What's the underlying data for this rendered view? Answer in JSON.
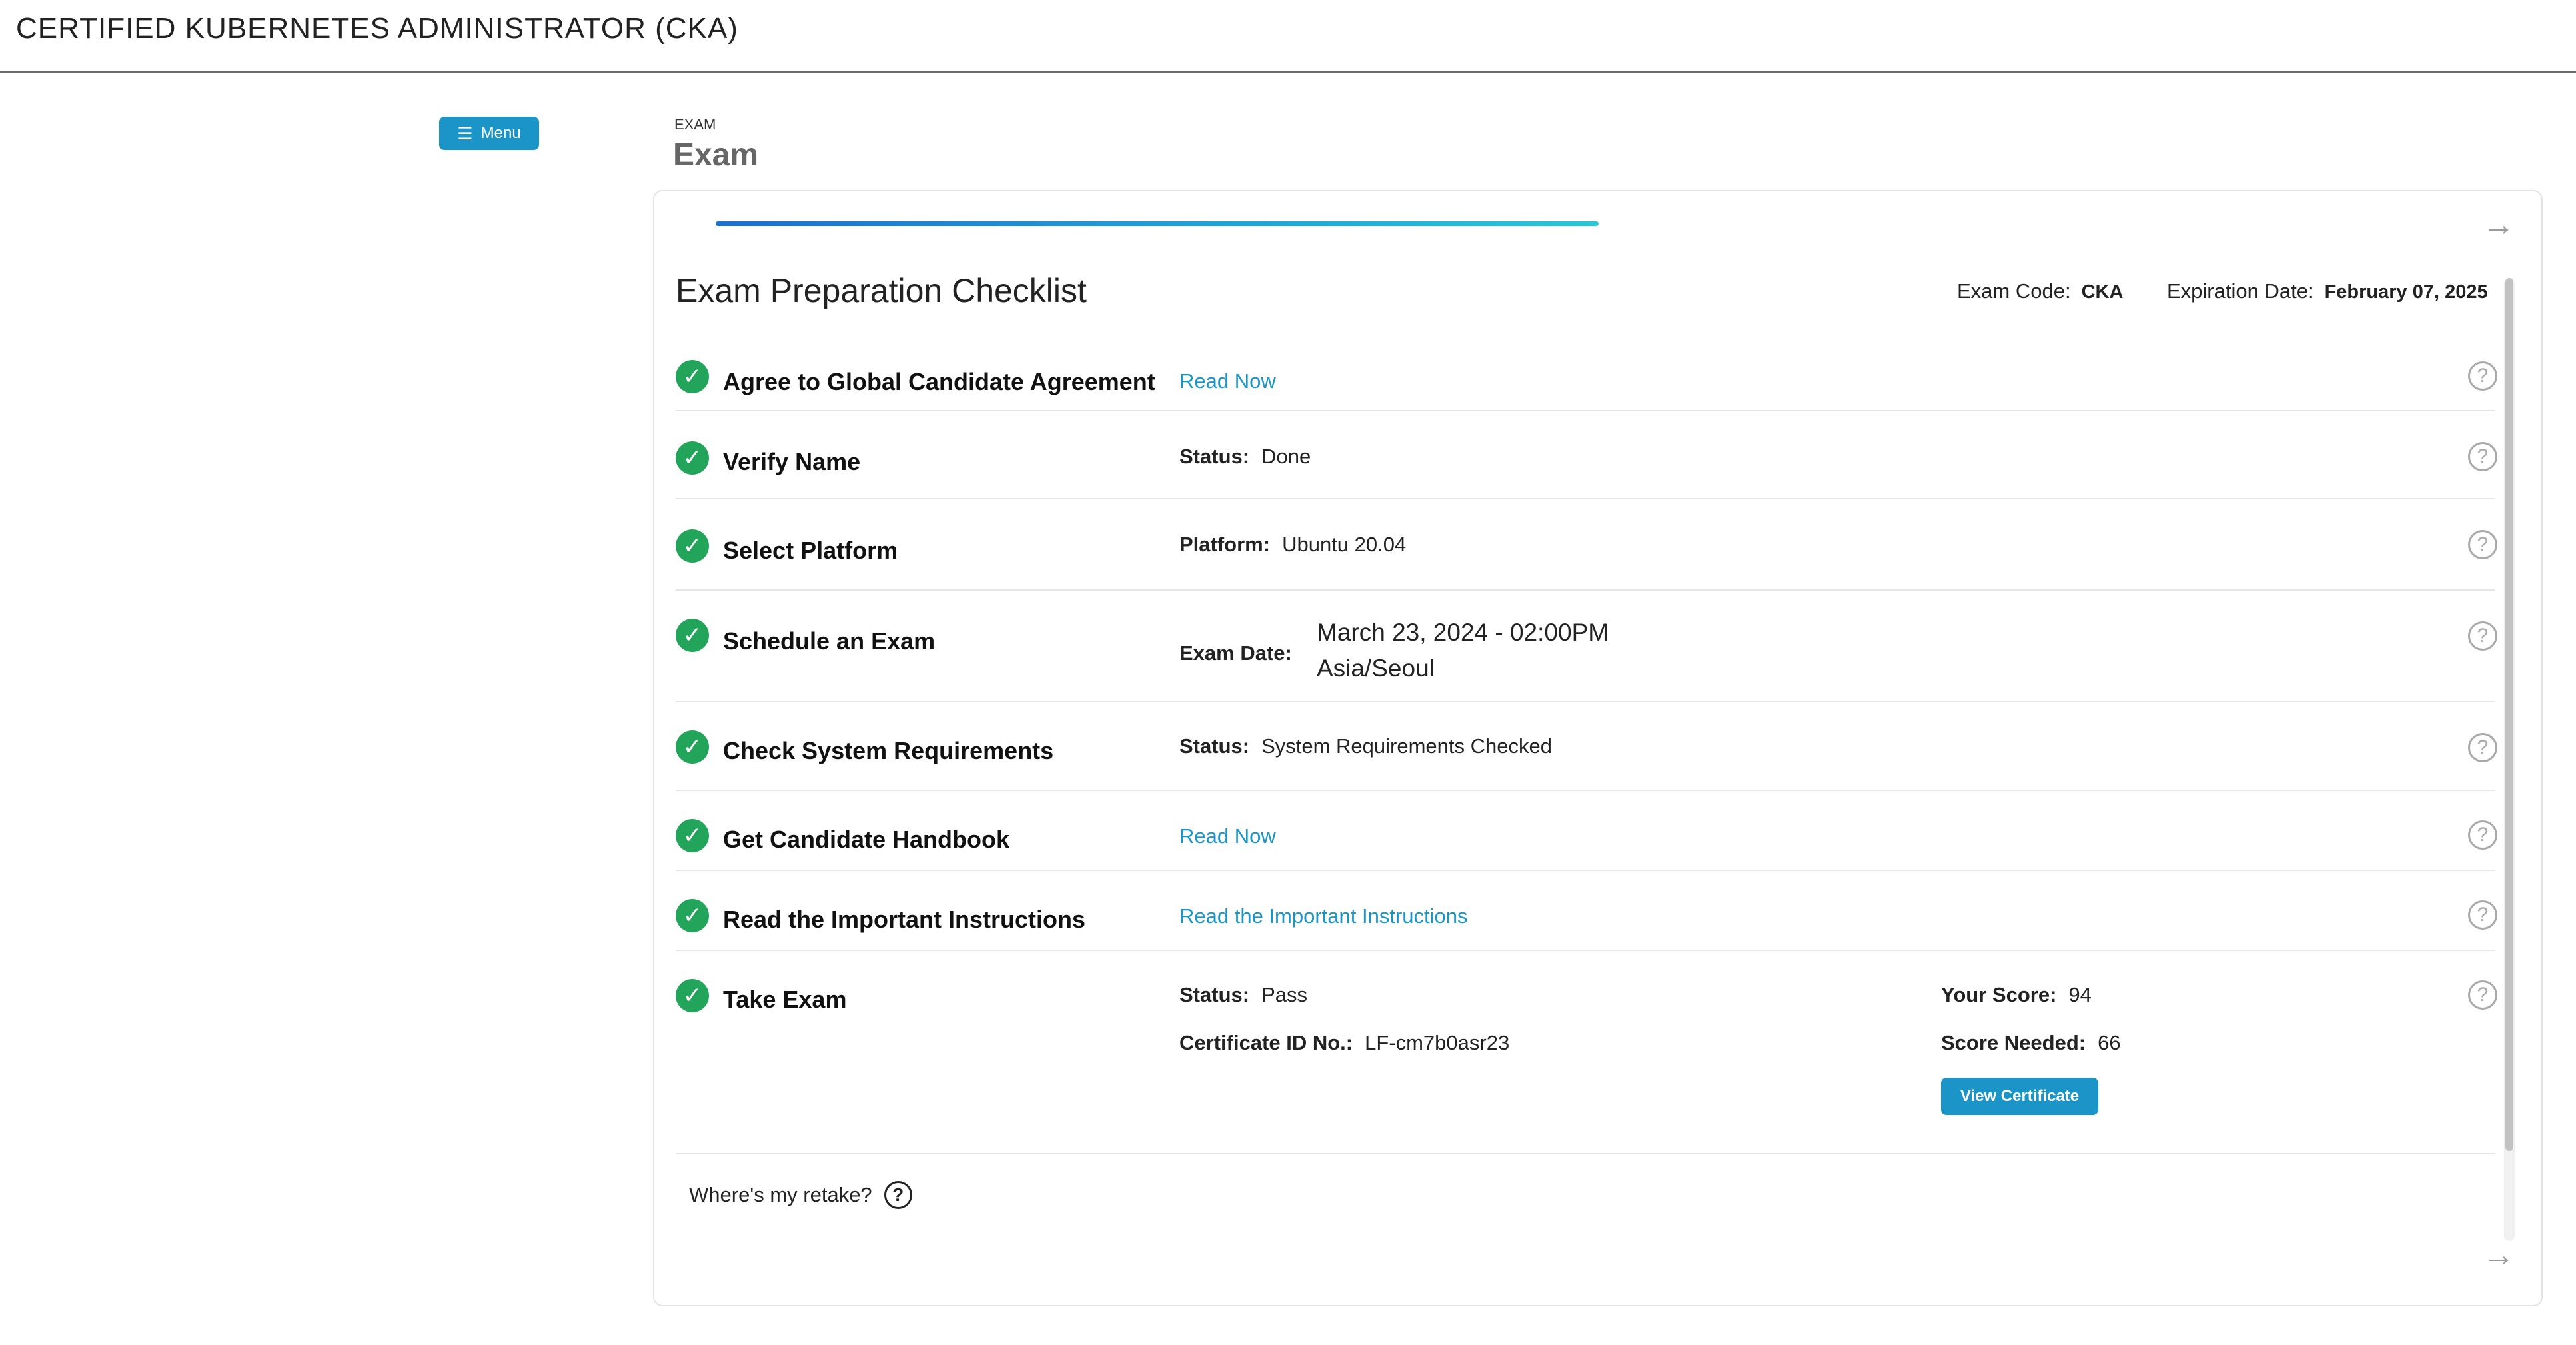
{
  "header": {
    "title": "CERTIFIED KUBERNETES ADMINISTRATOR (CKA)"
  },
  "menu": {
    "label": "Menu"
  },
  "page": {
    "breadcrumb": "EXAM",
    "title": "Exam"
  },
  "checklist": {
    "title": "Exam Preparation Checklist",
    "exam_code_label": "Exam Code:",
    "exam_code": "CKA",
    "expiration_label": "Expiration Date:",
    "expiration_date": "February 07, 2025",
    "items": [
      {
        "title": "Agree to Global Candidate Agreement",
        "link": "Read Now"
      },
      {
        "title": "Verify Name",
        "field_label": "Status:",
        "field_value": "Done"
      },
      {
        "title": "Select Platform",
        "field_label": "Platform:",
        "field_value": "Ubuntu 20.04"
      },
      {
        "title": "Schedule an Exam",
        "field_label": "Exam Date:",
        "date_line1": "March 23, 2024 - 02:00PM",
        "date_line2": "Asia/Seoul"
      },
      {
        "title": "Check System Requirements",
        "field_label": "Status:",
        "field_value": "System Requirements Checked"
      },
      {
        "title": "Get Candidate Handbook",
        "link": "Read Now"
      },
      {
        "title": "Read the Important Instructions",
        "link": "Read the Important Instructions"
      },
      {
        "title": "Take Exam",
        "status_label": "Status:",
        "status_value": "Pass",
        "cert_label": "Certificate ID No.:",
        "cert_value": "LF-cm7b0asr23",
        "score_label": "Your Score:",
        "score_value": "94",
        "needed_label": "Score Needed:",
        "needed_value": "66",
        "button": "View Certificate"
      }
    ]
  },
  "retake": {
    "label": "Where's my retake?"
  },
  "icons": {
    "check": "check-circle-icon",
    "help": "help-circle-icon",
    "arrow": "arrow-right-icon",
    "menu": "hamburger-icon"
  },
  "colors": {
    "accent": "#1b95c8",
    "check": "#22a55a"
  }
}
